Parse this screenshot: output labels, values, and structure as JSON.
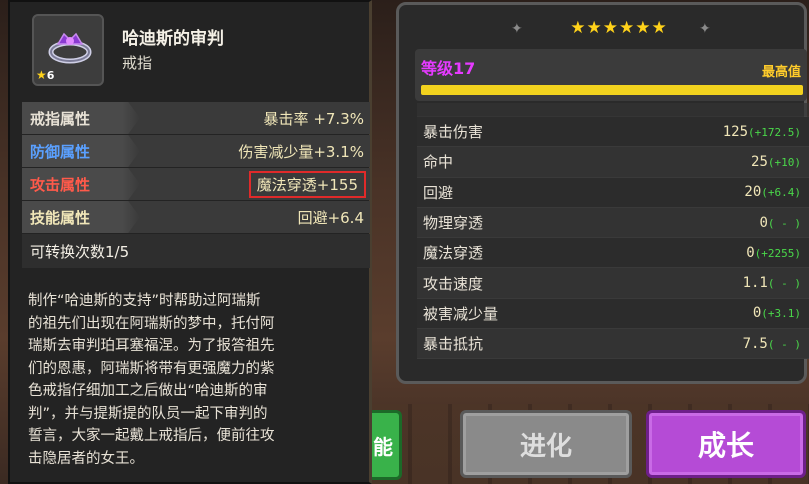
{
  "item": {
    "name": "哈迪斯的审判",
    "type": "戒指",
    "stars": "6",
    "attributes": [
      {
        "label": "戒指属性",
        "value": "暴击率 +7.3%",
        "kind": "ring"
      },
      {
        "label": "防御属性",
        "value": "伤害减少量+3.1%",
        "kind": "def"
      },
      {
        "label": "攻击属性",
        "value": "魔法穿透+155",
        "kind": "atk",
        "highlighted": true
      },
      {
        "label": "技能属性",
        "value": "回避+6.4",
        "kind": "skill"
      }
    ],
    "convert_count": "可转换次数1/5",
    "description": "制作“哈迪斯的支持”时帮助过阿瑞斯\n的祖先们出现在阿瑞斯的梦中，托付阿\n瑞斯去审判珀耳塞福涅。为了报答祖先\n们的恩惠，阿瑞斯将带有更强魔力的紫\n色戒指仔细加工之后做出“哈迪斯的审\n判”，并与提斯提的队员一起下审判的\n誓言，大家一起戴上戒指后，便前往攻\n击隐居者的女王。"
  },
  "stats_panel": {
    "stars": "★★★★★★",
    "level": "等级17",
    "level_max": "最高值",
    "level_progress": 1.0,
    "rows": [
      {
        "name": "暴击伤害",
        "value": "125",
        "bonus": "(+172.5)"
      },
      {
        "name": "命中",
        "value": "25",
        "bonus": "(+10)"
      },
      {
        "name": "回避",
        "value": "20",
        "bonus": "(+6.4)"
      },
      {
        "name": "物理穿透",
        "value": "0",
        "bonus": "( - )"
      },
      {
        "name": "魔法穿透",
        "value": "0",
        "bonus": "(+2255)"
      },
      {
        "name": "攻击速度",
        "value": "1.1",
        "bonus": "( - )"
      },
      {
        "name": "被害减少量",
        "value": "0",
        "bonus": "(+3.1)"
      },
      {
        "name": "暴击抵抗",
        "value": "7.5",
        "bonus": "( - )"
      }
    ]
  },
  "buttons": {
    "side": "能",
    "evolve": "进化",
    "grow": "成长"
  },
  "colors": {
    "accent_purple": "#b54bd6",
    "highlight_red": "#e02a2a",
    "level_yellow": "#f2d21e"
  }
}
